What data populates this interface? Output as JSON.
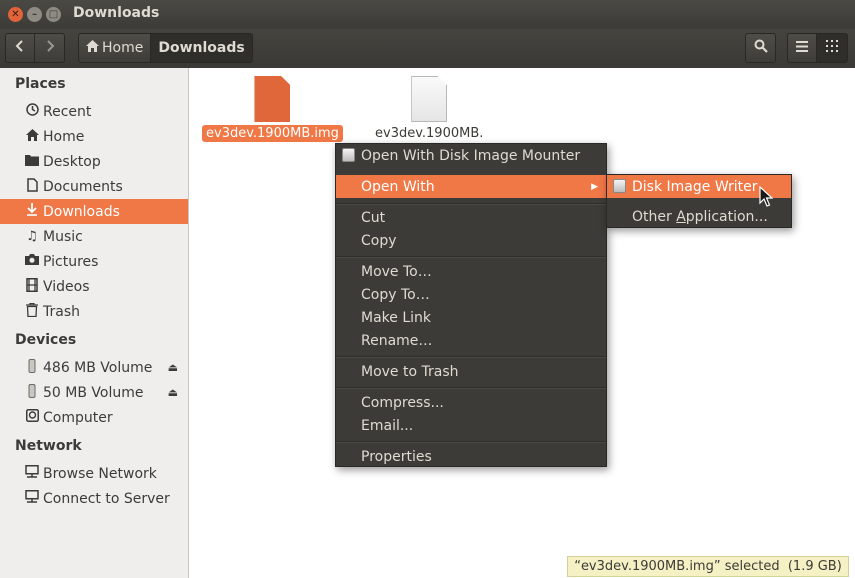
{
  "window": {
    "title": "Downloads"
  },
  "toolbar": {
    "breadcrumbs": [
      "Home",
      "Downloads"
    ]
  },
  "sidebar": {
    "sections": [
      "Places",
      "Devices",
      "Network"
    ],
    "places": [
      {
        "label": "Recent",
        "icon": "clock-icon"
      },
      {
        "label": "Home",
        "icon": "home-icon"
      },
      {
        "label": "Desktop",
        "icon": "desktop-folder-icon"
      },
      {
        "label": "Documents",
        "icon": "document-icon"
      },
      {
        "label": "Downloads",
        "icon": "download-icon"
      },
      {
        "label": "Music",
        "icon": "music-icon"
      },
      {
        "label": "Pictures",
        "icon": "camera-icon"
      },
      {
        "label": "Videos",
        "icon": "film-icon"
      },
      {
        "label": "Trash",
        "icon": "trash-icon"
      }
    ],
    "devices": [
      {
        "label": "486 MB Volume",
        "icon": "usb-drive-icon"
      },
      {
        "label": "50 MB Volume",
        "icon": "usb-drive-icon"
      },
      {
        "label": "Computer",
        "icon": "hard-disk-icon"
      }
    ],
    "network": [
      {
        "label": "Browse Network",
        "icon": "network-icon"
      },
      {
        "label": "Connect to Server",
        "icon": "server-icon"
      }
    ]
  },
  "files": [
    {
      "name": "ev3dev.1900MB.img",
      "selected": true
    },
    {
      "name": "ev3dev.1900MB.",
      "selected": false
    }
  ],
  "context_menu": {
    "items": [
      {
        "label": "Open With Disk Image Mounter"
      },
      {
        "label": "Open With"
      },
      {
        "label": "Cut"
      },
      {
        "label": "Copy"
      },
      {
        "label": "Move To…"
      },
      {
        "label": "Copy To…"
      },
      {
        "label": "Make Link"
      },
      {
        "label": "Rename…"
      },
      {
        "label": "Move to Trash"
      },
      {
        "label": "Compress..."
      },
      {
        "label": "Email..."
      },
      {
        "label": "Properties"
      }
    ]
  },
  "submenu": {
    "items": [
      {
        "label": "Disk Image Writer"
      },
      {
        "label_pre": "Other ",
        "label_u": "A",
        "label_post": "pplication..."
      }
    ]
  },
  "status": {
    "text": "“ev3dev.1900MB.img” selected  (1.9 GB)"
  },
  "colors": {
    "accent": "#f07746",
    "menu_bg": "#3c3b37",
    "sidebar_bg": "#efeeec"
  }
}
